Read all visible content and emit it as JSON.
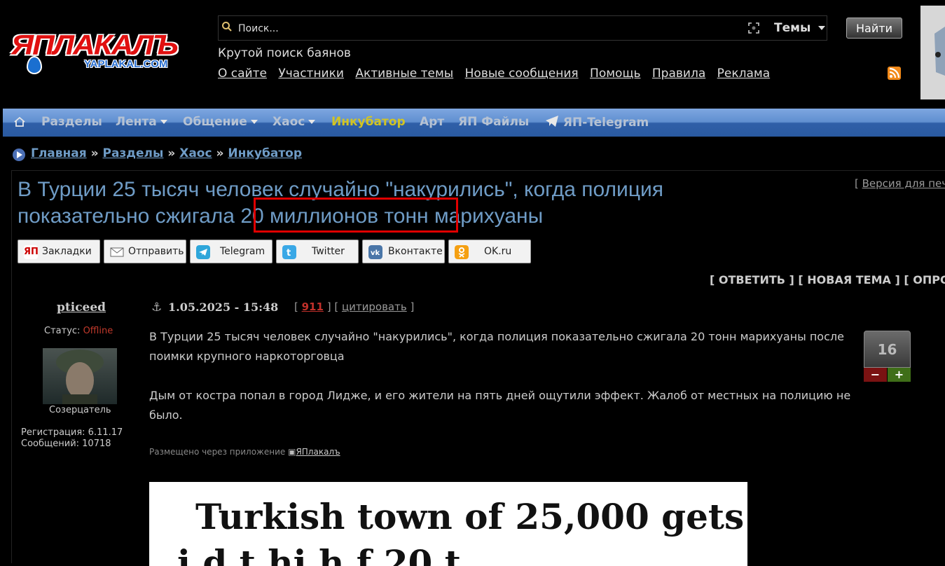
{
  "header": {
    "logo_text": "ЯПЛАКАЛЪ",
    "logo_sub": "YAPLAKAL.COM",
    "search_placeholder": "Поиск...",
    "themes_label": "Темы",
    "find_label": "Найти",
    "tagline": "Крутой поиск баянов",
    "links": [
      "О сайте",
      "Участники",
      "Активные темы",
      "Новые сообщения",
      "Помощь",
      "Правила",
      "Реклама"
    ]
  },
  "nav": {
    "items": [
      "Разделы",
      "Лента",
      "Общение",
      "Хаос",
      "Инкубатор",
      "Арт",
      "ЯП Файлы",
      "ЯП-Telegram"
    ]
  },
  "breadcrumb": [
    "Главная",
    "Разделы",
    "Хаос",
    "Инкубатор"
  ],
  "topic": {
    "title_part1": "В Турции 25 тысяч человек случайно \"накурились\", когда полиция показательно сжигала ",
    "title_highlight": "20 миллионов тонн",
    "title_part2": " марихуаны",
    "print_link": "Версия для печ"
  },
  "share": [
    "Закладки",
    "Отправить",
    "Telegram",
    "Twitter",
    "Вконтакте",
    "OK.ru"
  ],
  "actions": "[ ОТВЕТИТЬ ] [ НОВАЯ ТЕМА ] [ ОПРО",
  "post": {
    "author": "pticeed",
    "status_label": "Статус:",
    "status_value": "Offline",
    "rank": "Созерцатель",
    "registration": "Регистрация: 6.11.17",
    "messages": "Сообщений: 10718",
    "date": "1.05.2025 - 15:48",
    "post_number": "911",
    "quote_label": "цитировать",
    "body": [
      "В Турции 25 тысяч человек случайно \"накурились\", когда полиция показательно сжигала 20 тонн марихуаны после поимки крупного наркоторговца",
      "Дым от костра попал в город Лидже, и его жители на пять дней ощутили эффект. Жалоб от местных на полицию не было."
    ],
    "rating": "16",
    "vote_down": "−",
    "vote_up": "+",
    "via_text": "Размещено через приложение",
    "via_app": "ЯПлакалъ",
    "image_headline_1": "Turkish town of 25,000 gets",
    "image_headline_2": "i    d  t     hi h f     20 t"
  },
  "colors": {
    "link_blue": "#6f9cc6",
    "incubator_yellow": "#d2c423",
    "highlight_red": "#e00000",
    "offline_red": "#c0392b"
  }
}
